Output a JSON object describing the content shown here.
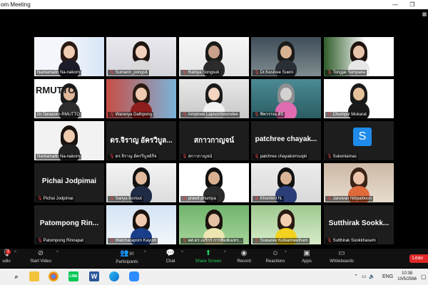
{
  "window": {
    "title": "om Meeting"
  },
  "participants": [
    {
      "name": "Nantamalin Na-nakorn",
      "muted": false,
      "video": true,
      "active": false,
      "big": ""
    },
    {
      "name": "Sumarin_pongsit",
      "muted": true,
      "video": true,
      "active": false,
      "big": ""
    },
    {
      "name": "Rattiya Songsuk",
      "muted": true,
      "video": true,
      "active": false,
      "big": ""
    },
    {
      "name": "Dr.Kesinee Sueni",
      "muted": true,
      "video": true,
      "active": false,
      "big": ""
    },
    {
      "name": "Tongjai Yampaka",
      "muted": true,
      "video": true,
      "active": false,
      "big": ""
    },
    {
      "name": "Dr.Tanasorn-RMUTTO",
      "muted": false,
      "video": true,
      "active": true,
      "big": "RMUTTO"
    },
    {
      "name": "Waranya Dathpong",
      "muted": true,
      "video": true,
      "active": false,
      "big": ""
    },
    {
      "name": "Ampinee Lapsomboondee",
      "muted": true,
      "video": true,
      "active": false,
      "big": ""
    },
    {
      "name": "พิพวรรณ ดีปี",
      "muted": true,
      "video": true,
      "active": false,
      "big": ""
    },
    {
      "name": "Chumpol Mokarat",
      "muted": true,
      "video": true,
      "active": false,
      "big": ""
    },
    {
      "name": "Nantamalin Na-nakorn",
      "muted": false,
      "video": true,
      "active": false,
      "big": ""
    },
    {
      "name": "ดร.จิราญ อัครวิบูลย์กิจ",
      "muted": true,
      "video": false,
      "active": false,
      "big": "ดร.จิราญ อัครวิบูล..."
    },
    {
      "name": "สกาวกาญจน์",
      "muted": true,
      "video": false,
      "active": false,
      "big": "สกาวกาญจน์"
    },
    {
      "name": "patchree chayakornsopit",
      "muted": true,
      "video": false,
      "active": false,
      "big": "patchree chayak..."
    },
    {
      "name": "Sukontamas",
      "muted": true,
      "video": false,
      "active": false,
      "big": "",
      "avatar": "S"
    },
    {
      "name": "Pichai Jodpimai",
      "muted": true,
      "video": false,
      "active": false,
      "big": "Pichai Jodpimai"
    },
    {
      "name": "Sanya Borisut",
      "muted": true,
      "video": true,
      "active": false,
      "big": ""
    },
    {
      "name": "prawit phumpa",
      "muted": true,
      "video": true,
      "active": false,
      "big": ""
    },
    {
      "name": "Khomkrit N.",
      "muted": true,
      "video": true,
      "active": false,
      "big": ""
    },
    {
      "name": "Jaruwan Nitipaiboon",
      "muted": true,
      "video": true,
      "active": false,
      "big": ""
    },
    {
      "name": "Patompong Rinnapat",
      "muted": true,
      "video": false,
      "active": false,
      "big": "Patompong Rin..."
    },
    {
      "name": "Watcharaporn Kayom",
      "muted": true,
      "video": true,
      "active": false,
      "big": ""
    },
    {
      "name": "ผศ.ดร.เมริกร์ การพิมพ์เมทร...",
      "muted": true,
      "video": true,
      "active": false,
      "big": ""
    },
    {
      "name": "Suwaree Kulkarineetham",
      "muted": true,
      "video": true,
      "active": false,
      "big": ""
    },
    {
      "name": "Sutthirak Sookkhasem",
      "muted": true,
      "video": false,
      "active": false,
      "big": "Sutthirak Sookk..."
    }
  ],
  "toolbar": {
    "audio": "udio",
    "start_video": "Start Video",
    "participants": "Participants",
    "participants_count": "30",
    "chat": "Chat",
    "share_screen": "Share Screen",
    "record": "Record",
    "reactions": "Reactions",
    "apps": "Apps",
    "whiteboards": "Whiteboards",
    "leave": "Leav",
    "audio_badge": "1"
  },
  "taskbar": {
    "apps": [
      "file-explorer",
      "chrome",
      "line",
      "word",
      "edge",
      "zoom"
    ],
    "language": "ENG",
    "time": "10:38",
    "date": "10/5/2566"
  },
  "colors": {
    "share_green": "#23d160",
    "leave_red": "#e02828",
    "active_yellow": "#e9e24a",
    "avatar_blue": "#1f8ceb"
  }
}
